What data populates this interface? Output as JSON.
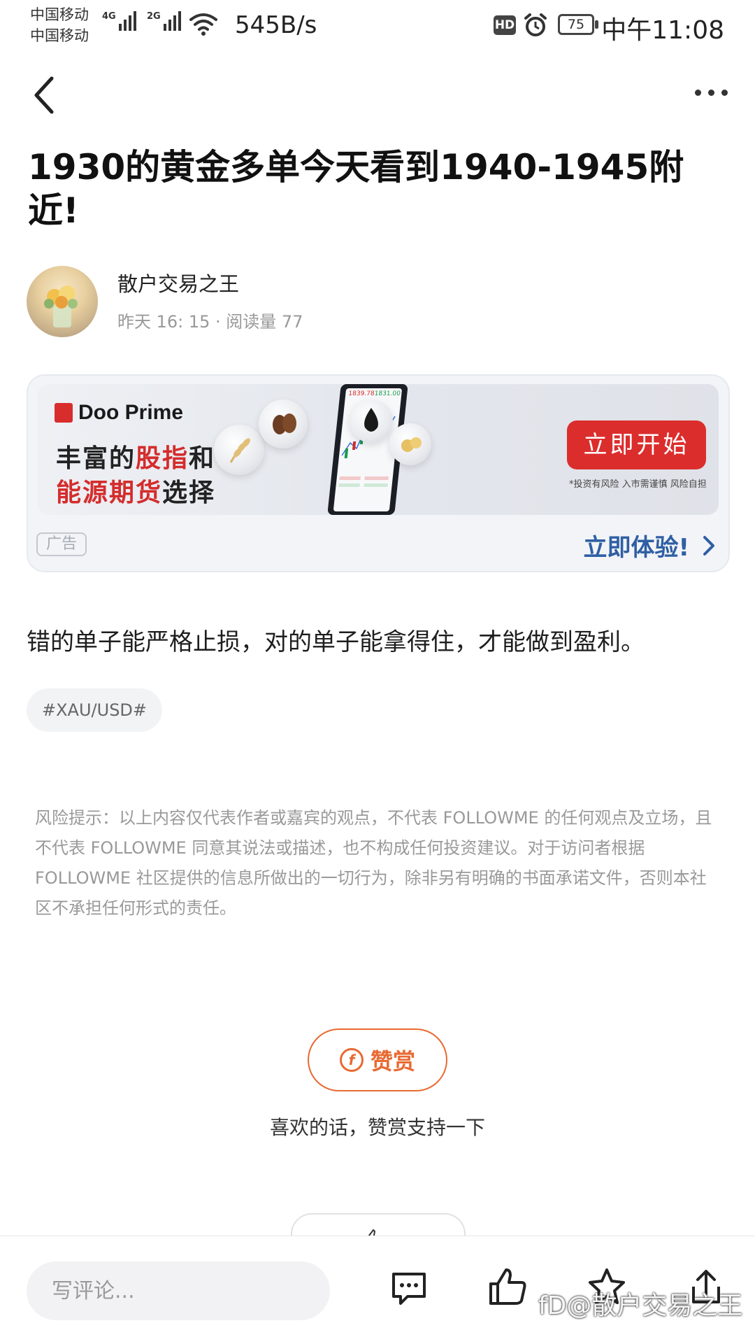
{
  "status_bar": {
    "carrier_1": "中国移动",
    "carrier_2": "中国移动",
    "network_1": "4G",
    "network_2": "2G",
    "net_speed": "545B/s",
    "hd": "HD",
    "battery": "75",
    "time": "中午11:08"
  },
  "nav": {
    "back_icon": "chevron-left-icon",
    "more_icon": "more-horizontal-icon"
  },
  "post": {
    "title": "1930的黄金多单今天看到1940-1945附近!",
    "author": "散户交易之王",
    "meta": "昨天 16: 15 · 阅读量 77",
    "body": "错的单子能严格止损，对的单子能拿得住，才能做到盈利。",
    "tag": "#XAU/USD#"
  },
  "ad": {
    "brand": "Doo Prime",
    "line1_a": "丰富的",
    "line1_b": "股指",
    "line1_c": "和",
    "line2_a": "能源期货",
    "line2_b": "选择",
    "cta": "立即开始",
    "disclaimer": "*投资有风险 入市需谨慎 风险自担",
    "phone_price_1": "1839.78",
    "phone_price_2": "1831.00",
    "badge": "广告",
    "experience": "立即体验!"
  },
  "disclaimer": "风险提示：以上内容仅代表作者或嘉宾的观点，不代表 FOLLOWME 的任何观点及立场，且不代表 FOLLOWME 同意其说法或描述，也不构成任何投资建议。对于访问者根据 FOLLOWME 社区提供的信息所做出的一切行为，除非另有明确的书面承诺文件，否则本社区不承担任何形式的责任。",
  "tip": {
    "button_label": "赞赏",
    "caption": "喜欢的话，赞赏支持一下"
  },
  "bottom_bar": {
    "comment_placeholder": "写评论...",
    "watermark": "fD@散户交易之王",
    "icons": [
      "comment-icon",
      "thumbs-up-icon",
      "star-icon",
      "share-icon"
    ]
  },
  "colors": {
    "accent_orange": "#e86a32",
    "ad_red": "#dc2d2d",
    "link_blue": "#2f5fa3"
  }
}
